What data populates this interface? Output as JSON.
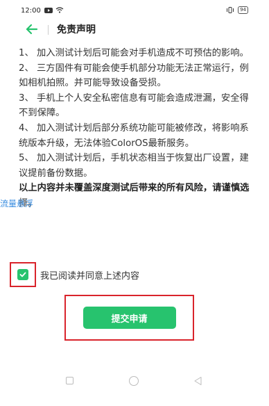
{
  "status_bar": {
    "time": "12:00",
    "battery": "94"
  },
  "header": {
    "title": "免责声明"
  },
  "content": {
    "paragraphs": [
      "1、 加入测试计划后可能会对手机造成不可预估的影响。",
      "2、 三方固件有可能会使手机部分功能无法正常运行，例如相机拍照。并可能导致设备受损。",
      "3、 手机上个人安全私密信息有可能会造成泄漏，安全得不到保障。",
      "4、 加入测试计划后部分系统功能可能被修改，将影响系统版本升级，无法体验ColorOS最新服务。",
      "5、 加入测试计划后，手机状态相当于恢复出厂设置，建议提前备份数据。"
    ],
    "warning": "以上内容并未覆盖深度测试后带来的所有风险，请谨慎选择。"
  },
  "overlay_tag": "流量悬浮",
  "agreement": {
    "label": "我已阅读并同意上述内容",
    "checked": true
  },
  "submit": {
    "label": "提交申请"
  },
  "colors": {
    "accent": "#27c36e",
    "highlight": "#d9232b"
  }
}
